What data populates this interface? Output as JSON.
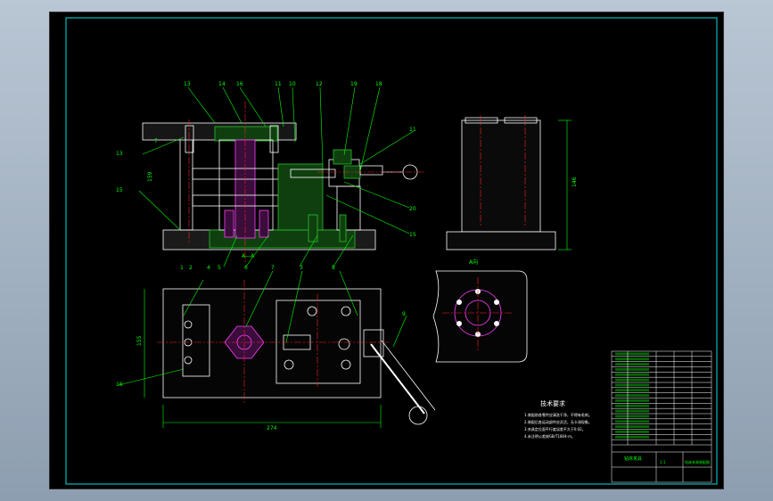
{
  "colors": {
    "background_gradient_top": "#b9c6d4",
    "background_gradient_bottom": "#8d9eb0",
    "sheet_background": "#000000",
    "frame_border": "#00e0e0",
    "geometry": "#ffffff",
    "leaders": "#00ff00",
    "centerlines": "#ff2020",
    "highlight_parts": "#ff40ff",
    "dimension_text": "#00ff00"
  },
  "drawing": {
    "section_label": "A—A",
    "view_label": "A向",
    "dimensions": {
      "overall_length": "274",
      "base_width": "155",
      "height_main": "159",
      "height_side": "146",
      "small": "7"
    },
    "balloons_top": [
      "13",
      "14",
      "16",
      "11",
      "10",
      "12",
      "19",
      "18"
    ],
    "balloons_bottom": [
      "1",
      "2",
      "3",
      "4",
      "5",
      "6",
      "7",
      "8"
    ],
    "balloons_plan": [
      "1",
      "2",
      "4",
      "7",
      "8",
      "3",
      "9"
    ],
    "balloons_right": [
      "11",
      "20",
      "15"
    ],
    "balloons_left": [
      "13",
      "15",
      "16"
    ]
  },
  "tech_notes": {
    "title": "技术要求",
    "lines": [
      "1.装配前各零件应清洗干净，不得有毛刺。",
      "2.装配后各运动部件应灵活，无卡滞现象。",
      "3.夹具定位面平行度误差不大于0.02。",
      "4.未注明公差按GB/T1804-m。"
    ]
  },
  "title_block": {
    "title": "钻床夹具",
    "drawing_no": "钻床夹具装配图",
    "scale": "1:1",
    "parts_rows": 18
  }
}
